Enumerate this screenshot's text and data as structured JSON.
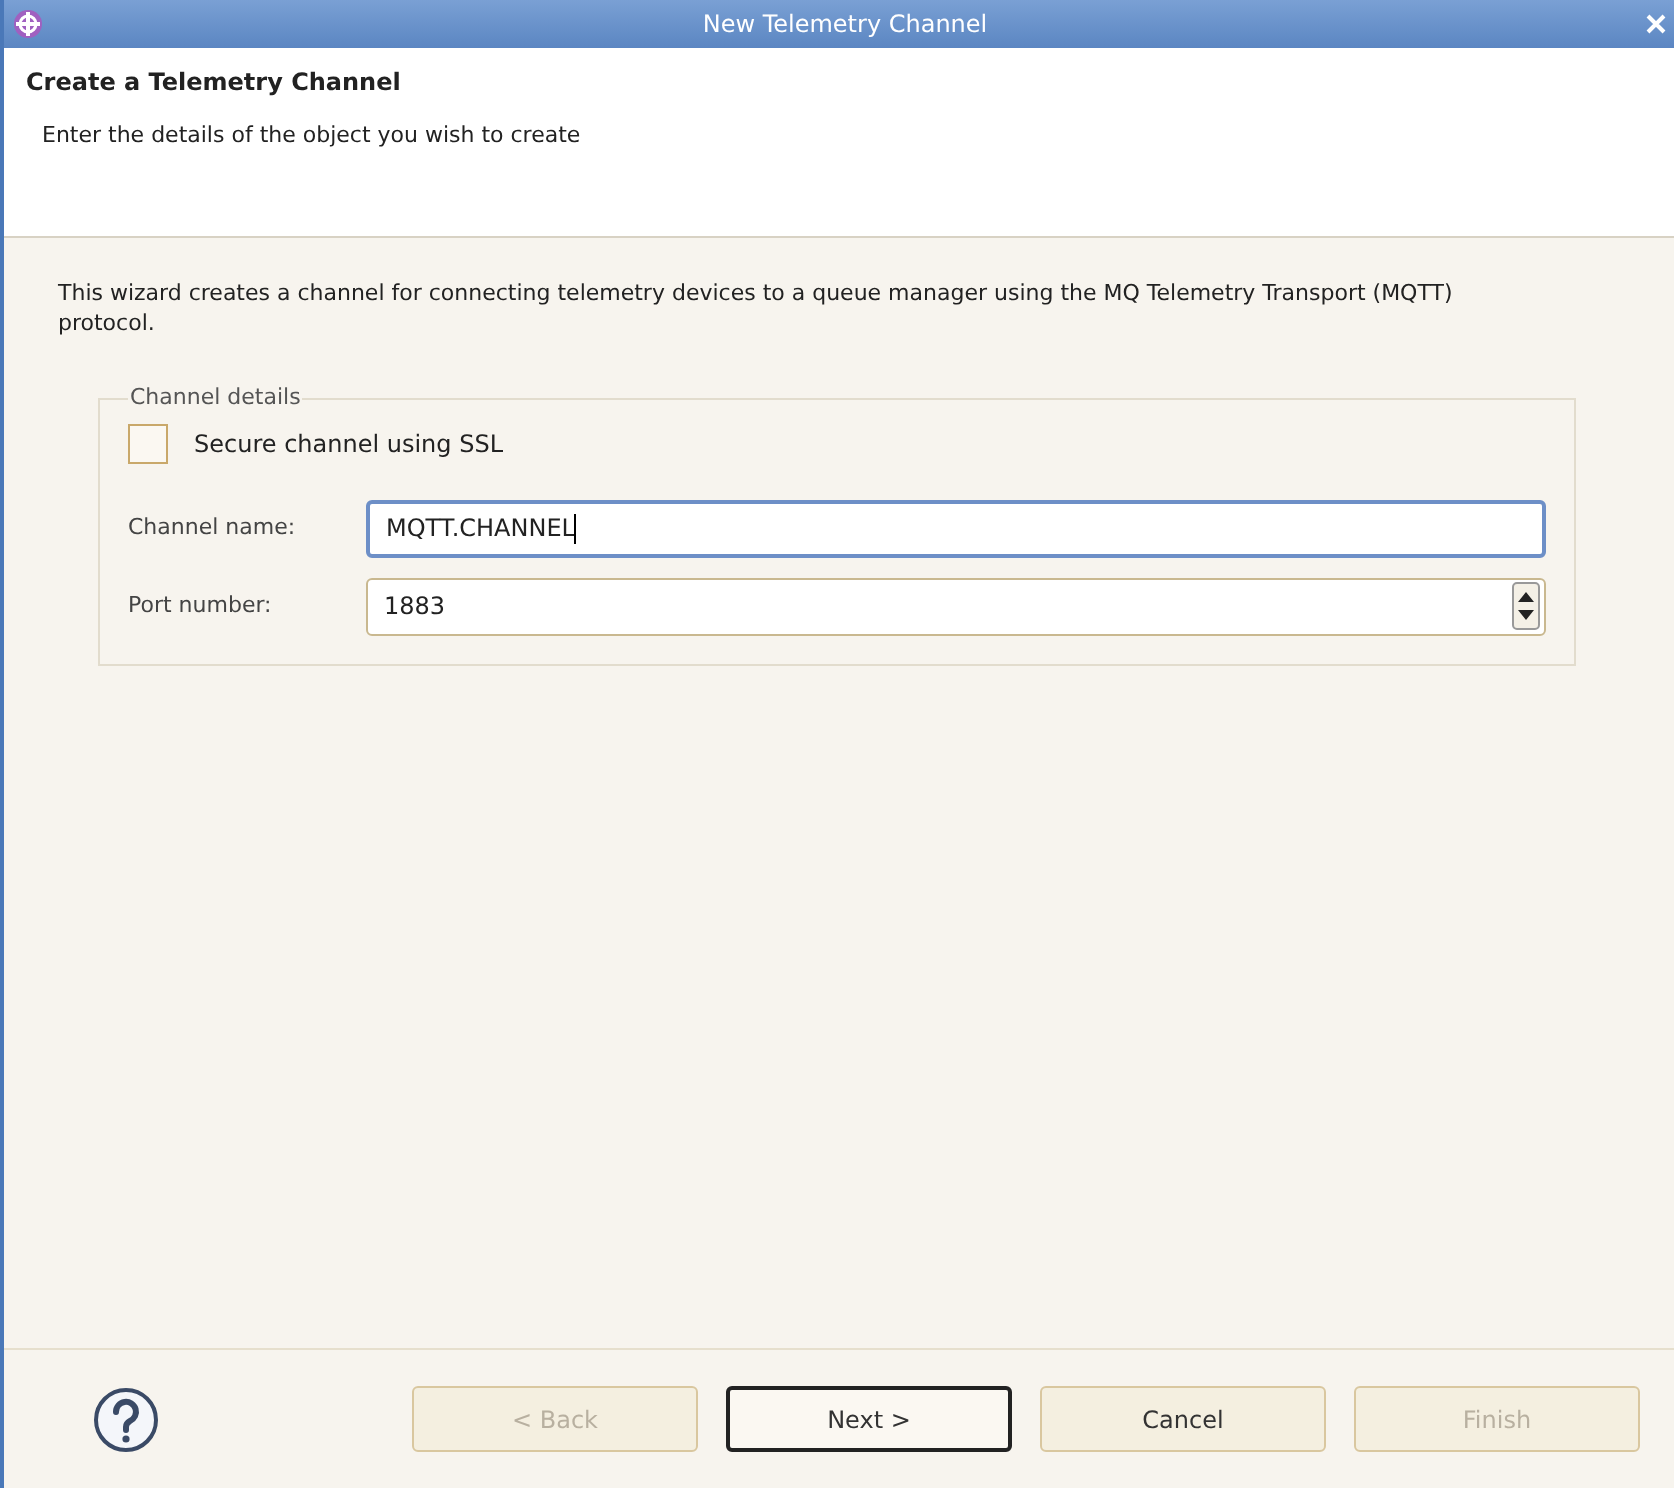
{
  "window": {
    "title": "New Telemetry Channel"
  },
  "header": {
    "title": "Create a Telemetry Channel",
    "subtitle": "Enter the details of the object you wish to create"
  },
  "description": "This wizard creates a channel for connecting telemetry devices to a queue manager using the MQ Telemetry Transport (MQTT) protocol.",
  "group": {
    "title": "Channel details",
    "checkbox": {
      "label": "Secure channel using SSL",
      "checked": false
    },
    "fields": [
      {
        "kind": "text",
        "label": "Channel name:",
        "value": "MQTT.CHANNEL",
        "focused": true
      },
      {
        "kind": "spinner",
        "label": "Port number:",
        "value": "1883",
        "focused": false
      }
    ]
  },
  "buttons": [
    {
      "label": "< Back",
      "disabled": true,
      "default": false
    },
    {
      "label": "Next >",
      "disabled": false,
      "default": true
    },
    {
      "label": "Cancel",
      "disabled": false,
      "default": false
    },
    {
      "label": "Finish",
      "disabled": true,
      "default": false
    }
  ]
}
